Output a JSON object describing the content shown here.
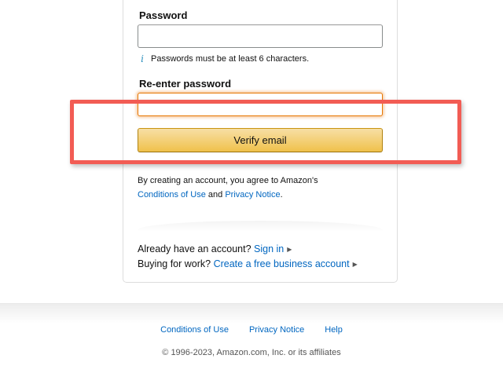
{
  "form": {
    "password_label": "Password",
    "password_value": "",
    "password_hint": "Passwords must be at least 6 characters.",
    "info_icon_glyph": "i",
    "reenter_label": "Re-enter password",
    "reenter_value": "",
    "verify_button_label": "Verify email"
  },
  "legal": {
    "prefix": "By creating an account, you agree to Amazon's",
    "conditions_link": "Conditions of Use",
    "and": "and",
    "privacy_link": "Privacy Notice",
    "suffix": "."
  },
  "account": {
    "have_account_text": "Already have an account?",
    "sign_in_link": "Sign in",
    "business_text": "Buying for work?",
    "business_link": "Create a free business account",
    "caret_icon": "caret-right-icon"
  },
  "footer": {
    "links": [
      "Conditions of Use",
      "Privacy Notice",
      "Help"
    ],
    "copyright": "© 1996-2023, Amazon.com, Inc. or its affiliates"
  },
  "colors": {
    "link": "#0066c0",
    "button_top": "#f7dfa5",
    "button_bottom": "#f0c14b",
    "focus_border": "#e77600",
    "annotation_box": "#f25c54"
  }
}
